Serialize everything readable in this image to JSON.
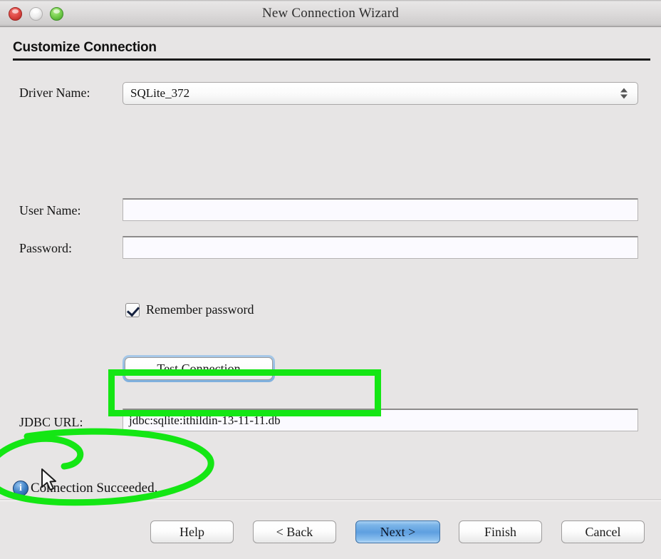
{
  "window": {
    "title": "New Connection Wizard",
    "traffic_lights": [
      {
        "name": "close",
        "color": "#e04a45"
      },
      {
        "name": "minimize",
        "color": "#eeeeee"
      },
      {
        "name": "maximize",
        "color": "#76cf4e"
      }
    ]
  },
  "page": {
    "heading": "Customize Connection"
  },
  "form": {
    "driver": {
      "label": "Driver Name:",
      "value": "SQLite_372"
    },
    "user_name": {
      "label": "User Name:",
      "value": "",
      "placeholder": ""
    },
    "password": {
      "label": "Password:",
      "value": "",
      "placeholder": ""
    },
    "remember_password": {
      "label": "Remember password",
      "checked": true
    },
    "test_connection": {
      "label": "Test Connection"
    },
    "jdbc_url": {
      "label": "JDBC URL:",
      "value": "jdbc:sqlite:ithildin-13-11-11.db",
      "placeholder": ""
    }
  },
  "status": {
    "icon": "info-icon",
    "message": "Connection Succeeded."
  },
  "buttons": {
    "help": "Help",
    "back": "< Back",
    "next": "Next >",
    "finish": "Finish",
    "cancel": "Cancel"
  },
  "annotations": {
    "highlight_color": "#14e614",
    "rect_target": "jdbc-url-field",
    "ellipse_target": "status-message"
  }
}
